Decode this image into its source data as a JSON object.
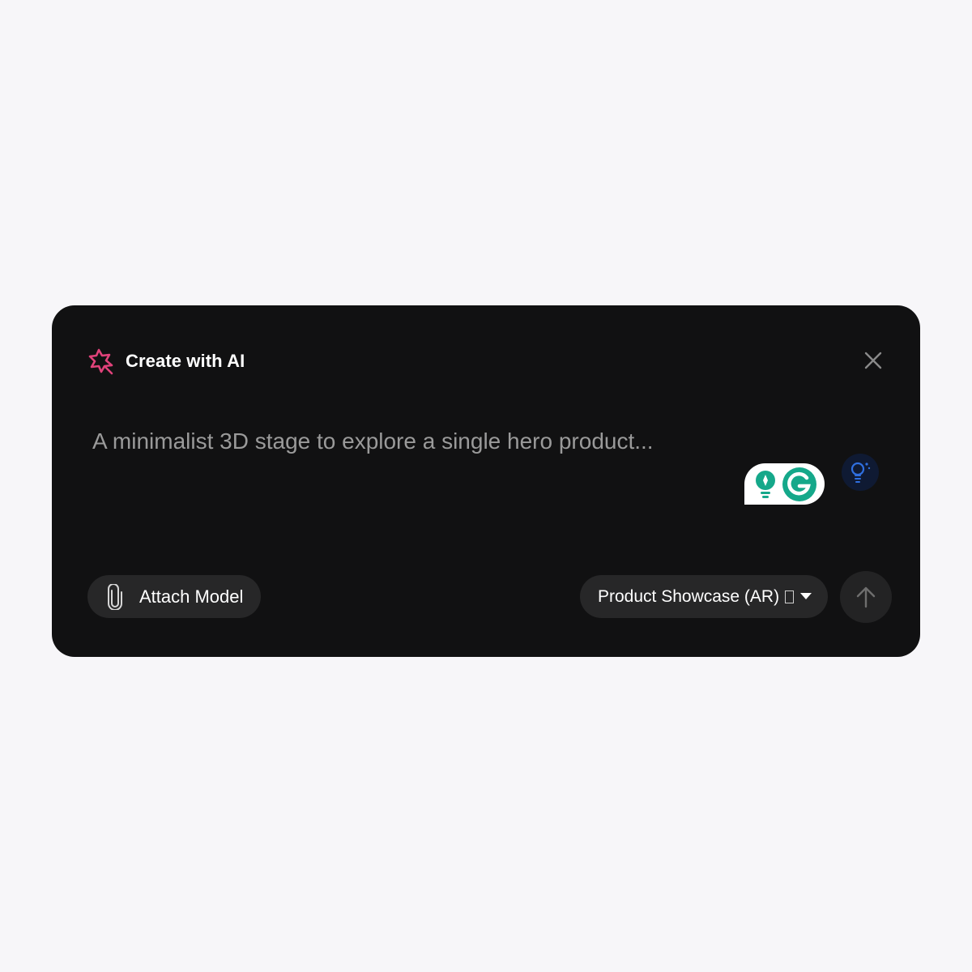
{
  "dialog": {
    "title": "Create with AI",
    "title_icon": "sparkle-icon",
    "close_icon": "close-icon"
  },
  "prompt": {
    "placeholder": "A minimalist 3D stage to explore a single hero product..."
  },
  "grammarly": {
    "icons": [
      "grammarly-suggestion-icon",
      "grammarly-g-icon"
    ],
    "brand_color": "#15c39a"
  },
  "hint": {
    "icon": "lightbulb-icon",
    "color": "#2f6fe0"
  },
  "toolbar": {
    "attach_label": "Attach Model",
    "attach_icon": "paperclip-icon",
    "mode_label": "Product Showcase (AR)",
    "mode_icon": "dropdown-caret-icon",
    "send_icon": "arrow-up-icon"
  },
  "colors": {
    "accent": "#e0427a",
    "panel_bg": "#111112",
    "page_bg": "#f7f6f9"
  }
}
